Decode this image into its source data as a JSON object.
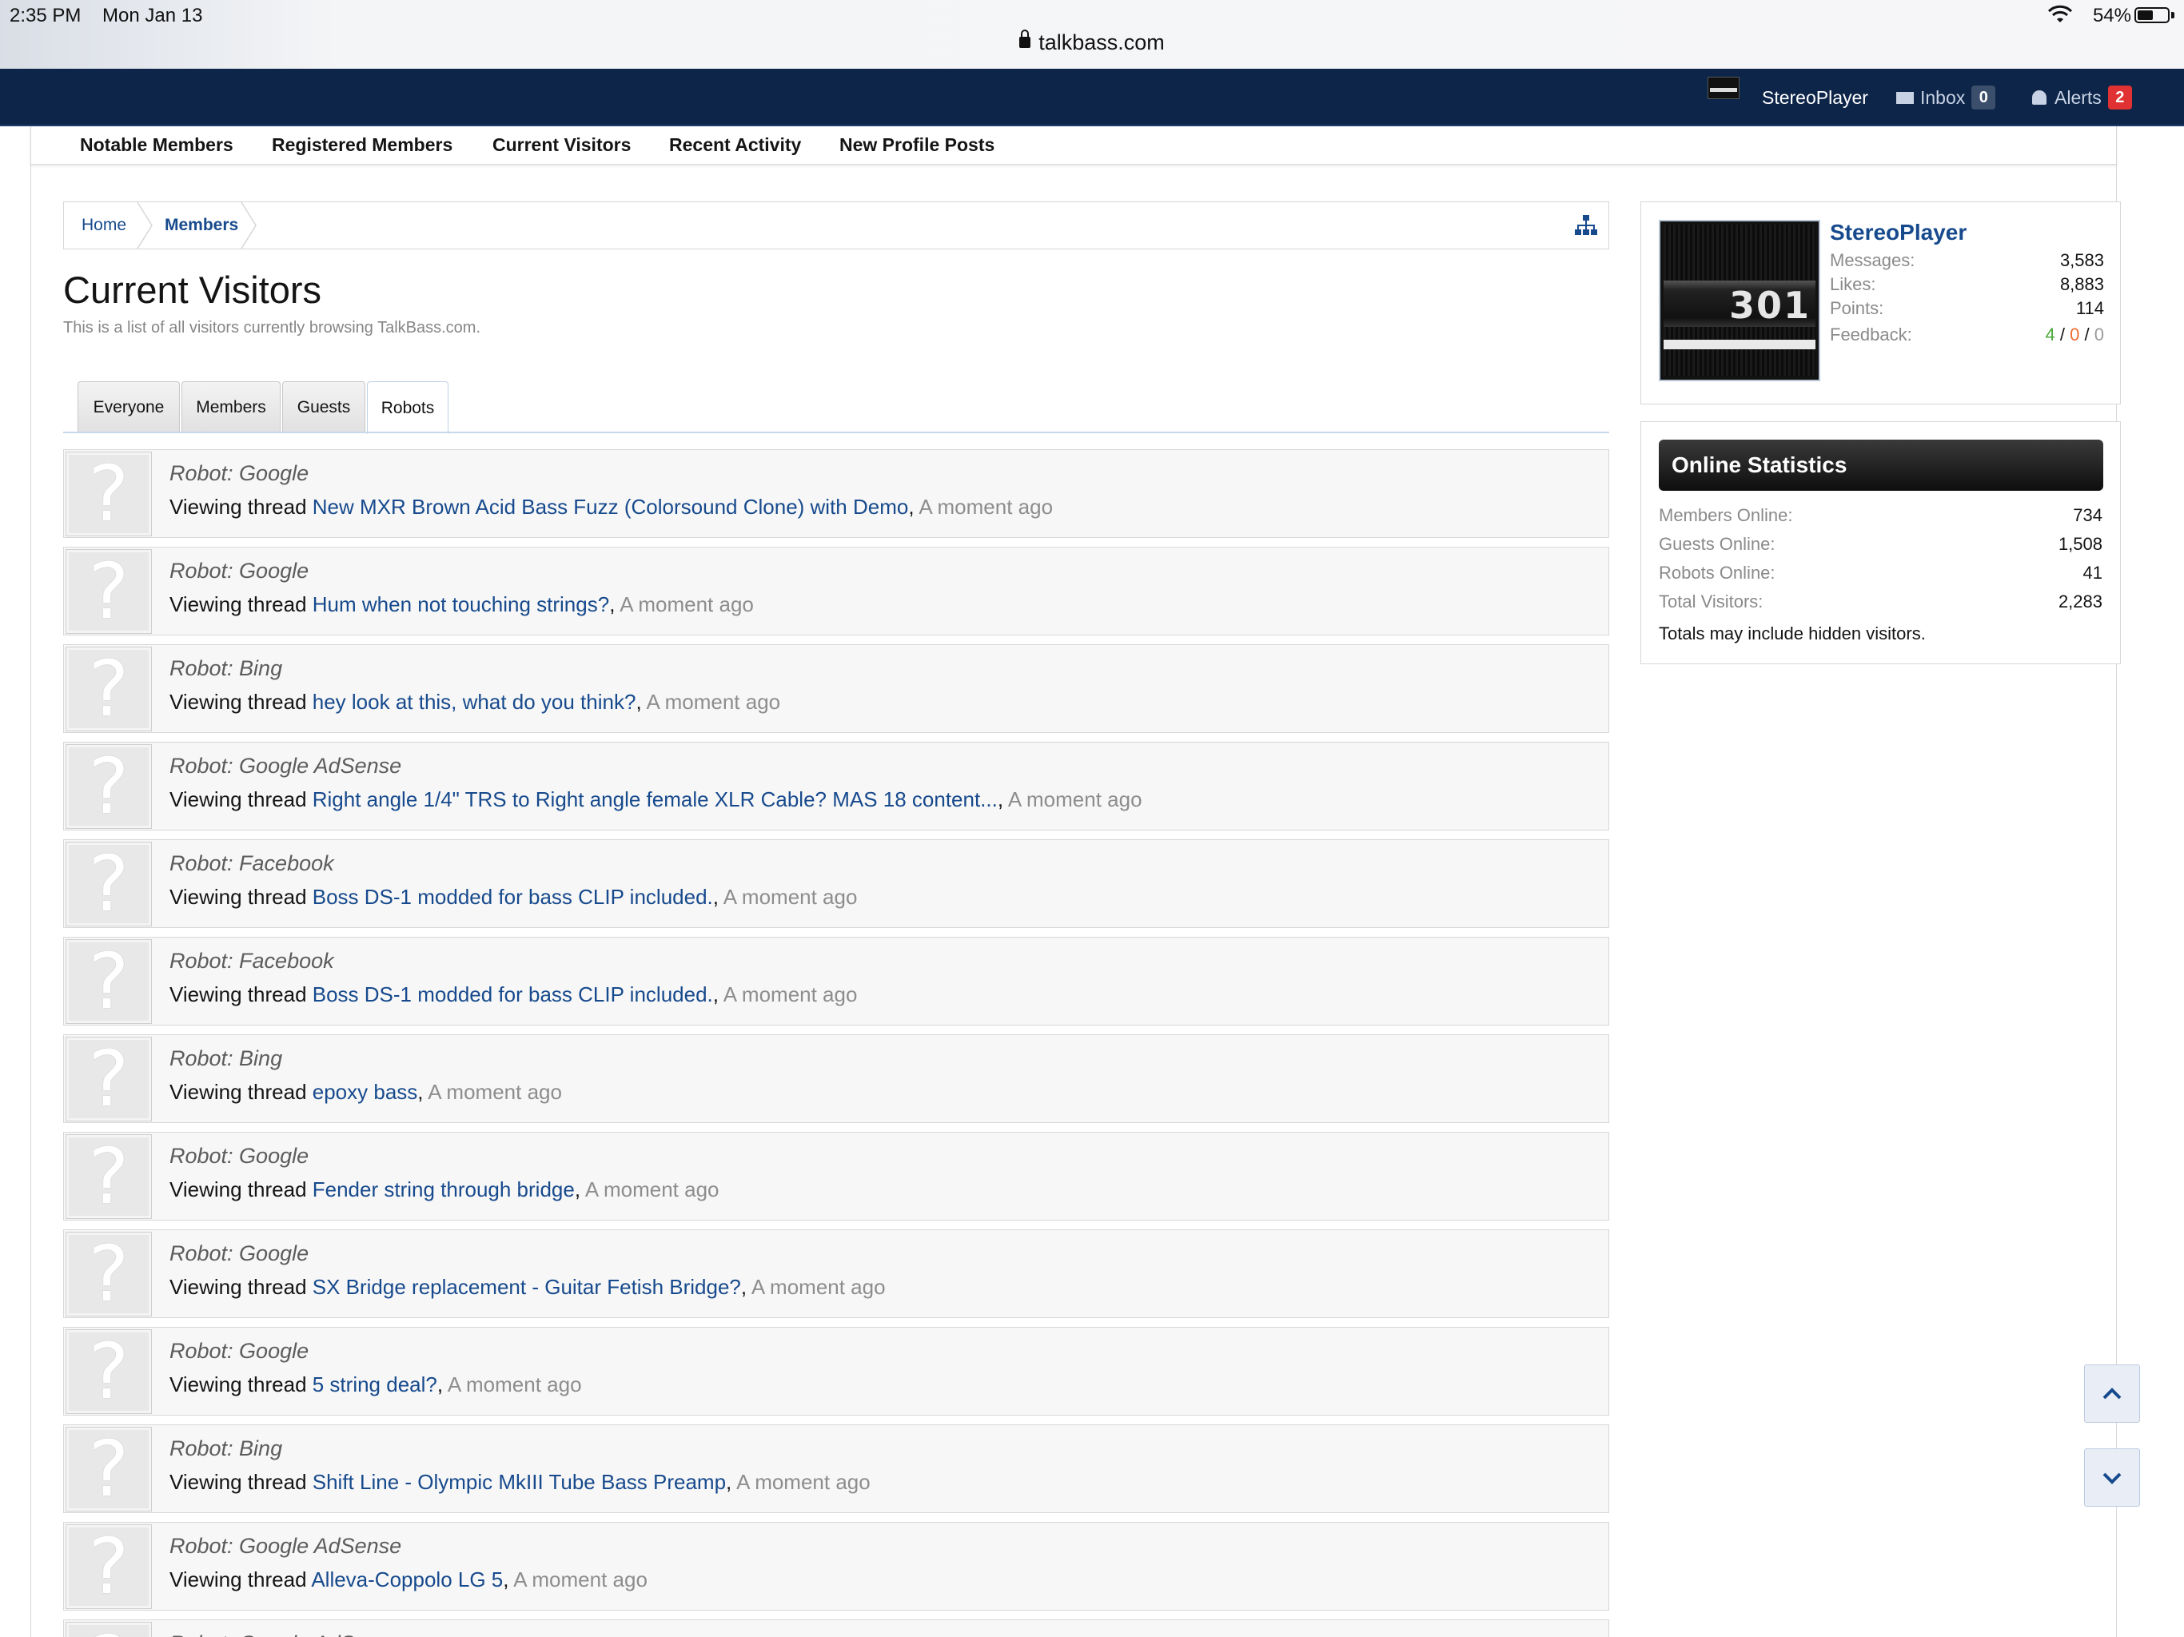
{
  "status_bar": {
    "time": "2:35 PM",
    "date": "Mon Jan 13",
    "battery": "54%",
    "battery_level": 0.54,
    "url": "talkbass.com"
  },
  "top_bar": {
    "username": "StereoPlayer",
    "inbox_label": "Inbox",
    "inbox_count": "0",
    "alerts_label": "Alerts",
    "alerts_count": "2"
  },
  "sub_nav": [
    {
      "label": "Notable Members"
    },
    {
      "label": "Registered Members"
    },
    {
      "label": "Current Visitors"
    },
    {
      "label": "Recent Activity"
    },
    {
      "label": "New Profile Posts"
    }
  ],
  "breadcrumb": {
    "home": "Home",
    "members": "Members"
  },
  "page": {
    "title": "Current Visitors",
    "description": "This is a list of all visitors currently browsing TalkBass.com."
  },
  "tabs": [
    {
      "label": "Everyone",
      "active": false
    },
    {
      "label": "Members",
      "active": false
    },
    {
      "label": "Guests",
      "active": false
    },
    {
      "label": "Robots",
      "active": true
    }
  ],
  "visitors": [
    {
      "robot": "Robot: Google",
      "action": "Viewing thread ",
      "thread": "New MXR Brown Acid Bass Fuzz (Colorsound Clone) with Demo",
      "time": "A moment ago"
    },
    {
      "robot": "Robot: Google",
      "action": "Viewing thread ",
      "thread": "Hum when not touching strings?",
      "time": "A moment ago"
    },
    {
      "robot": "Robot: Bing",
      "action": "Viewing thread ",
      "thread": "hey look at this, what do you think?",
      "time": "A moment ago"
    },
    {
      "robot": "Robot: Google AdSense",
      "action": "Viewing thread ",
      "thread": "Right angle 1/4\" TRS to Right angle female XLR Cable? MAS 18 content...",
      "time": "A moment ago"
    },
    {
      "robot": "Robot: Facebook",
      "action": "Viewing thread ",
      "thread": "Boss DS-1 modded for bass CLIP included.",
      "time": "A moment ago"
    },
    {
      "robot": "Robot: Facebook",
      "action": "Viewing thread ",
      "thread": "Boss DS-1 modded for bass CLIP included.",
      "time": "A moment ago"
    },
    {
      "robot": "Robot: Bing",
      "action": "Viewing thread ",
      "thread": "epoxy bass",
      "time": "A moment ago"
    },
    {
      "robot": "Robot: Google",
      "action": "Viewing thread ",
      "thread": "Fender string through bridge",
      "time": "A moment ago"
    },
    {
      "robot": "Robot: Google",
      "action": "Viewing thread ",
      "thread": "SX Bridge replacement - Guitar Fetish Bridge?",
      "time": "A moment ago"
    },
    {
      "robot": "Robot: Google",
      "action": "Viewing thread ",
      "thread": "5 string deal?",
      "time": "A moment ago"
    },
    {
      "robot": "Robot: Bing",
      "action": "Viewing thread ",
      "thread": "Shift Line - Olympic MkIII Tube Bass Preamp",
      "time": "A moment ago"
    },
    {
      "robot": "Robot: Google AdSense",
      "action": "Viewing thread ",
      "thread": "Alleva-Coppolo LG 5",
      "time": "A moment ago"
    },
    {
      "robot": "Robot: Google AdSense",
      "action": "",
      "thread": "",
      "time": ""
    }
  ],
  "user_box": {
    "avatar_text": "301",
    "name": "StereoPlayer",
    "messages_label": "Messages:",
    "messages": "3,583",
    "likes_label": "Likes:",
    "likes": "8,883",
    "points_label": "Points:",
    "points": "114",
    "feedback_label": "Feedback:",
    "feedback_positive": "4",
    "feedback_neutral": "0",
    "feedback_negative": "0",
    "feedback_sep": "/"
  },
  "online_stats": {
    "title": "Online Statistics",
    "members_label": "Members Online:",
    "members": "734",
    "guests_label": "Guests Online:",
    "guests": "1,508",
    "robots_label": "Robots Online:",
    "robots": "41",
    "total_label": "Total Visitors:",
    "total": "2,283",
    "note": "Totals may include hidden visitors."
  },
  "icons": {
    "avatar_placeholder": "?",
    "scroll_up": "chevron-up-icon",
    "scroll_down": "chevron-down-icon",
    "sitemap": "sitemap-icon"
  },
  "colors": {
    "nav_bg": "#0d2549",
    "link": "#174a8d",
    "alerts_badge": "#e03232",
    "feedback_positive": "#4caa3a",
    "feedback_neutral": "#f06b2f"
  }
}
